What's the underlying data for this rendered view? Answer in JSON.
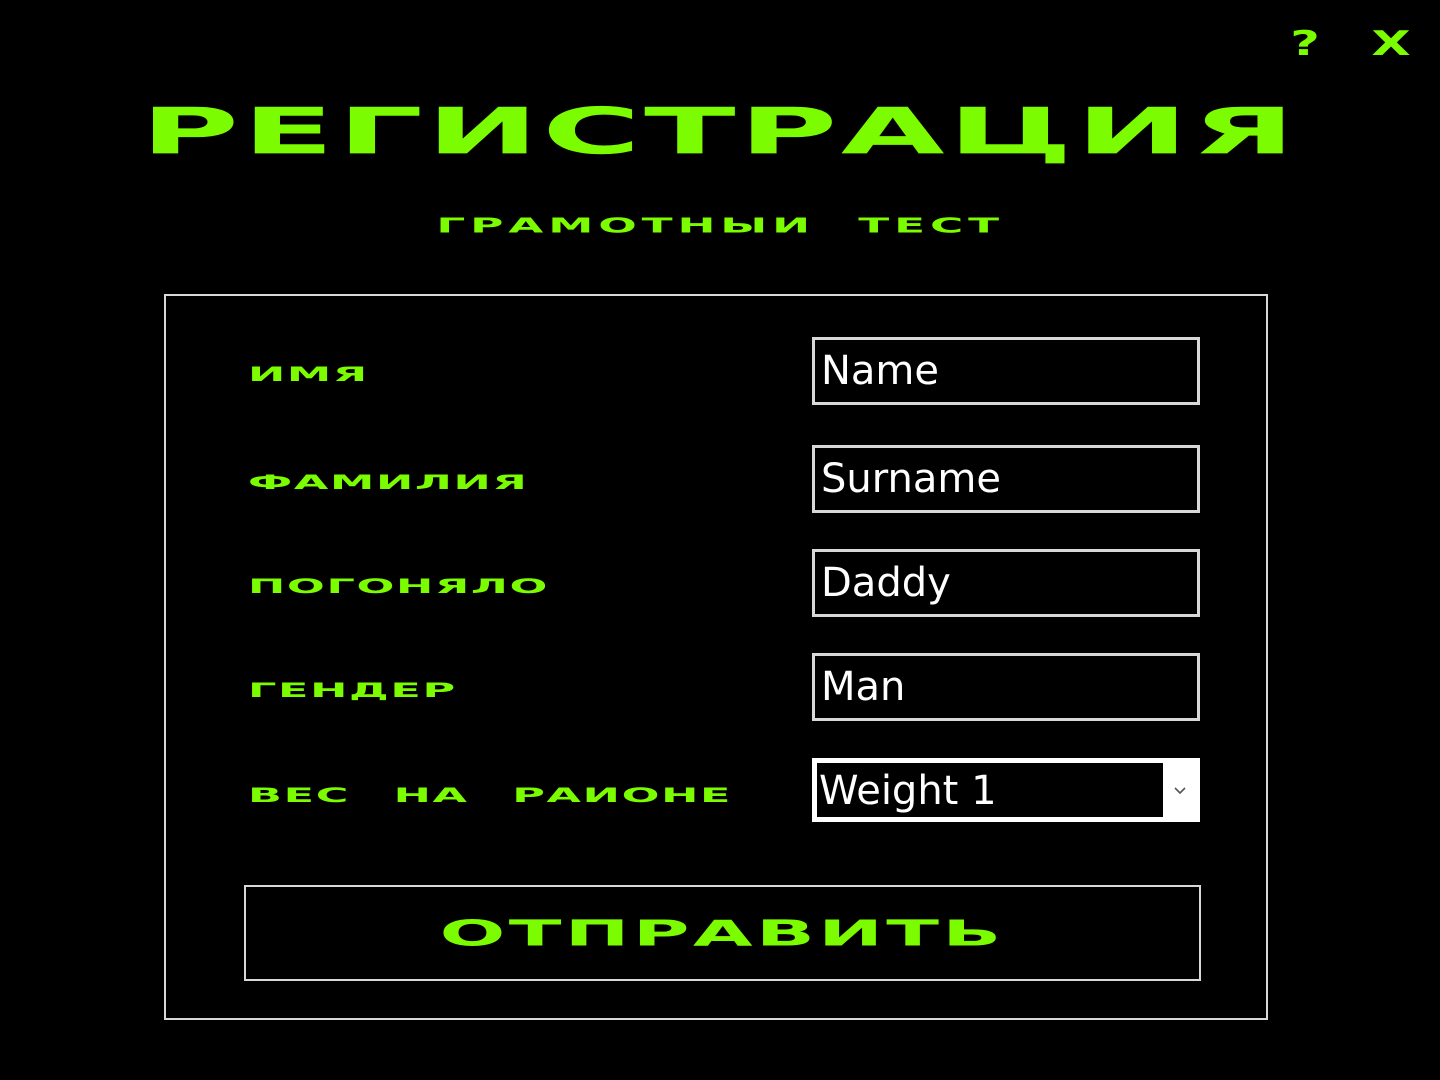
{
  "window": {
    "help_label": "?",
    "close_label": "X"
  },
  "header": {
    "title": "Регистрация",
    "subtitle": "Грамотныи тест"
  },
  "form": {
    "fields": [
      {
        "label": "Имя",
        "value": "Name"
      },
      {
        "label": "Фамилия",
        "value": "Surname"
      },
      {
        "label": "Погоняло",
        "value": "Daddy"
      },
      {
        "label": "Гендер",
        "value": "Man"
      }
    ],
    "weight": {
      "label": "Вес на раионе",
      "selected": "Weight 1",
      "arrow_icon": "chevron-down-icon"
    },
    "submit_label": "Отправить"
  },
  "colors": {
    "accent": "#7CFC00",
    "background": "#000000",
    "border": "#D8D8D8",
    "text": "#FFFFFF"
  }
}
